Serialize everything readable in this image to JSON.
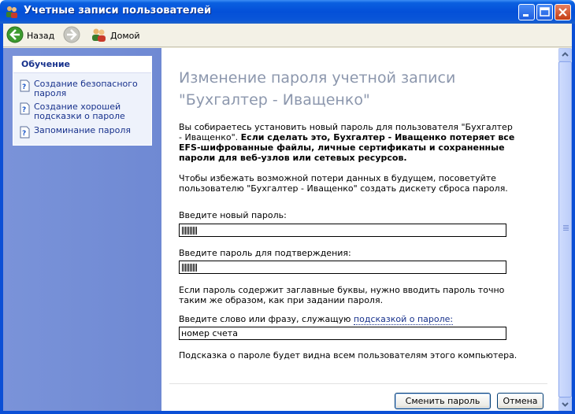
{
  "window": {
    "title": "Учетные записи пользователей",
    "icon": "users-icon"
  },
  "toolbar": {
    "back_label": "Назад",
    "home_label": "Домой"
  },
  "learning": {
    "header": "Обучение",
    "items": [
      {
        "label": "Создание безопасного пароля"
      },
      {
        "label": "Создание хорошей подсказки о пароле"
      },
      {
        "label": "Запоминание пароля"
      }
    ]
  },
  "main": {
    "heading": "Изменение пароля учетной записи \"Бухгалтер - Иващенко\"",
    "intro_plain": "Вы собираетесь установить новый пароль для пользователя \"Бухгалтер - Иващенко\". ",
    "intro_bold": "Если сделать это, Бухгалтер - Иващенко потеряет все EFS-шифрованные файлы, личные сертификаты и сохраненные пароли для веб-узлов или сетевых ресурсов.",
    "advice": "Чтобы избежать возможной потери данных в будущем, посоветуйте пользователю \"Бухгалтер - Иващенко\" создать дискету сброса пароля.",
    "new_password_label": "Введите новый пароль:",
    "new_password_value_length": 10,
    "confirm_password_label": "Введите пароль для подтверждения:",
    "confirm_password_value_length": 10,
    "case_note": "Если пароль содержит заглавные буквы, нужно вводить пароль точно таким же образом, как при задании пароля.",
    "hint_label_prefix": "Введите слово или фразу, служащую ",
    "hint_label_link": "подсказкой о пароле:",
    "hint_value": "номер счета",
    "hint_note": "Подсказка о пароле будет видна всем пользователям этого компьютера."
  },
  "buttons": {
    "change_label": "Сменить пароль",
    "cancel_label": "Отмена"
  },
  "colors": {
    "titlebar": "#0450d8",
    "heading": "#8c97ad",
    "link": "#17318c",
    "left_pane": "#7a93d9"
  }
}
